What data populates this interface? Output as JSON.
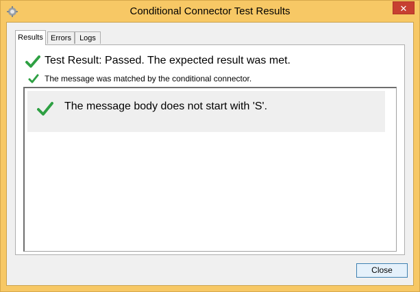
{
  "window": {
    "title": "Conditional Connector Test Results",
    "close_glyph": "✕",
    "app_icon": "gear-icon",
    "frame_color": "#f7c865"
  },
  "tabs": [
    {
      "label": "Results",
      "active": true
    },
    {
      "label": "Errors",
      "active": false
    },
    {
      "label": "Logs",
      "active": false
    }
  ],
  "results": {
    "headline": "Test Result: Passed. The expected result was met.",
    "subline": "The message was matched by the conditional connector.",
    "items": [
      {
        "icon": "check-icon",
        "text": "The message body does not start with 'S'."
      }
    ],
    "check_color": "#2ea043"
  },
  "footer": {
    "close_label": "Close"
  }
}
